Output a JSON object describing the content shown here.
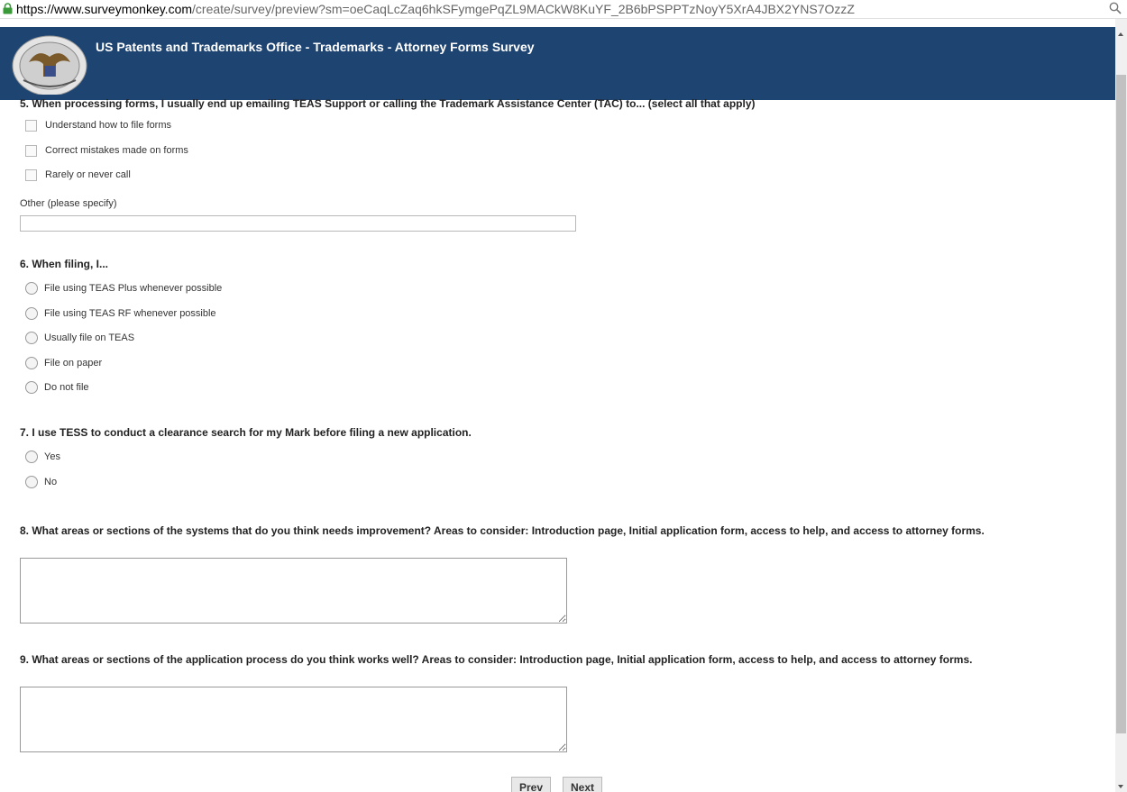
{
  "browser": {
    "url_host": "https://www.surveymonkey.com",
    "url_path": "/create/survey/preview?sm=oeCaqLcZaq6hkSFymgePqZL9MACkW8KuYF_2B6bPSPPTzNoyY5XrA4JBX2YNS7OzzZ"
  },
  "header": {
    "title": "US Patents and Trademarks Office - Trademarks - Attorney Forms Survey",
    "bg_color": "#1e4471"
  },
  "q5": {
    "text": "5. When processing forms, I usually end up emailing TEAS Support or calling the Trademark Assistance Center (TAC) to... (select all that apply)",
    "options": [
      "Understand how to file forms",
      "Correct mistakes made on forms",
      "Rarely or never call"
    ],
    "other_label": "Other (please specify)"
  },
  "q6": {
    "text": "6. When filing, I...",
    "options": [
      "File using TEAS Plus whenever possible",
      "File using TEAS RF whenever possible",
      "Usually file on TEAS",
      "File on paper",
      "Do not file"
    ]
  },
  "q7": {
    "text": "7. I use TESS to conduct a clearance search for my Mark before filing a new application.",
    "options": [
      "Yes",
      "No"
    ]
  },
  "q8": {
    "text": "8. What areas or sections of the systems that do you think needs improvement? Areas to consider: Introduction page, Initial application form, access to help, and access to attorney forms."
  },
  "q9": {
    "text": "9. What areas or sections of the application process do you think works well? Areas to consider: Introduction page, Initial application form, access to help, and access to attorney forms."
  },
  "nav": {
    "prev": "Prev",
    "next": "Next"
  }
}
